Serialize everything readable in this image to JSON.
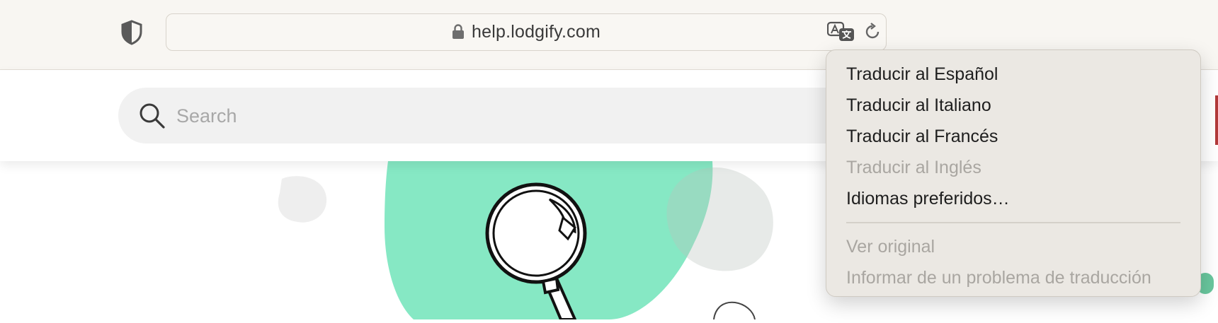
{
  "browser": {
    "url": "help.lodgify.com"
  },
  "search": {
    "placeholder": "Search"
  },
  "translate_menu": {
    "items": [
      {
        "label": "Traducir al Español",
        "enabled": true
      },
      {
        "label": "Traducir al Italiano",
        "enabled": true
      },
      {
        "label": "Traducir al Francés",
        "enabled": true
      },
      {
        "label": "Traducir al Inglés",
        "enabled": false
      },
      {
        "label": "Idiomas preferidos…",
        "enabled": true
      }
    ],
    "secondary_items": [
      {
        "label": "Ver original",
        "enabled": false
      },
      {
        "label": "Informar de un problema de traducción",
        "enabled": false
      }
    ]
  },
  "colors": {
    "accent_green": "#86e8c4",
    "toolbar_bg": "#f8f6f2",
    "menu_bg": "#ebe8e3"
  }
}
